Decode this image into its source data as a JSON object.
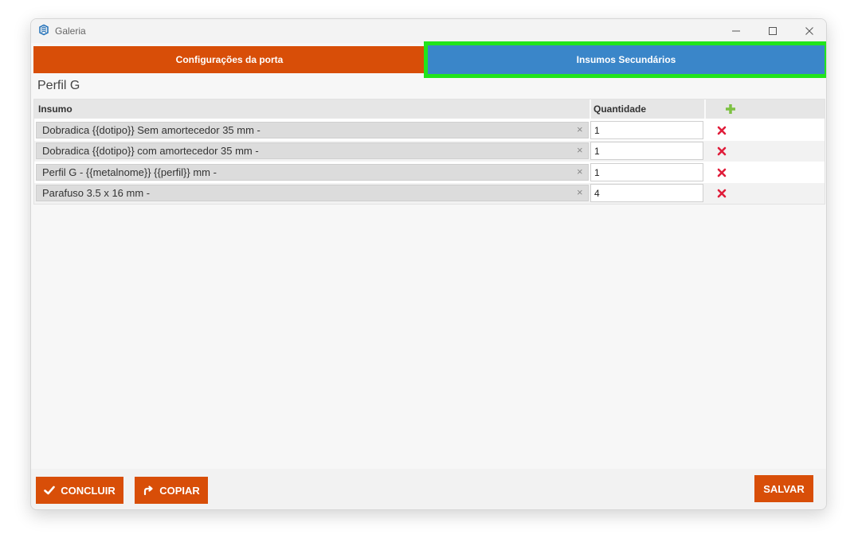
{
  "window": {
    "title": "Galeria"
  },
  "tabs": [
    {
      "label": "Configurações da porta",
      "color": "#d84e08"
    },
    {
      "label": "Insumos Secundários",
      "color": "#3a86c9",
      "highlight": "#21e41c"
    }
  ],
  "section_title": "Perfil G",
  "table": {
    "headers": {
      "insumo": "Insumo",
      "quantidade": "Quantidade"
    },
    "rows": [
      {
        "insumo": "Dobradica {{dotipo}} Sem amortecedor 35 mm -",
        "quantidade": "1"
      },
      {
        "insumo": "Dobradica {{dotipo}} com amortecedor 35 mm -",
        "quantidade": "1"
      },
      {
        "insumo": "Perfil G - {{metalnome}} {{perfil}} mm -",
        "quantidade": "1"
      },
      {
        "insumo": "Parafuso 3.5 x 16 mm -",
        "quantidade": "4"
      }
    ],
    "clear_symbol": "×"
  },
  "buttons": {
    "concluir": "CONCLUIR",
    "copiar": "COPIAR",
    "salvar": "SALVAR"
  },
  "colors": {
    "accent": "#d84e08",
    "tab_active": "#3a86c9",
    "add": "#7dc142",
    "delete": "#e01d3a"
  }
}
